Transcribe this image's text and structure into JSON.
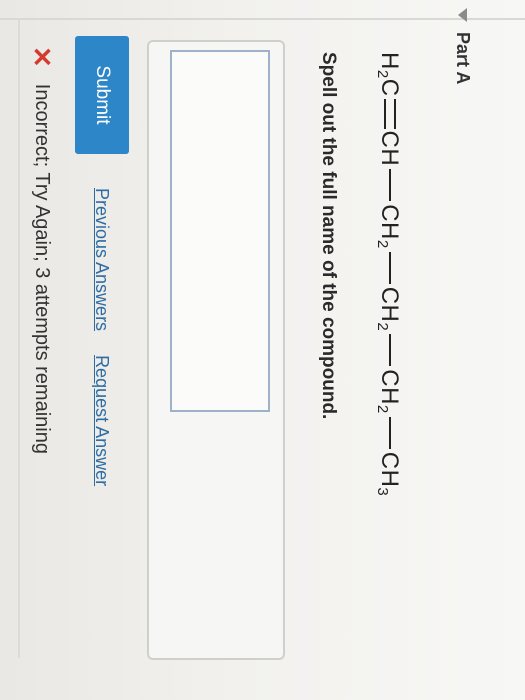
{
  "part": {
    "title": "Part A"
  },
  "question": {
    "formula": {
      "g1": "H",
      "g1_sub": "2",
      "g1_tail": "C",
      "g2": "CH",
      "g3": "CH",
      "g3_sub": "2",
      "g4": "CH",
      "g4_sub": "2",
      "g5": "CH",
      "g5_sub": "2",
      "g6": "CH",
      "g6_sub": "3"
    },
    "instruction": "Spell out the full name of the compound."
  },
  "answer": {
    "value": "",
    "placeholder": ""
  },
  "actions": {
    "submit_label": "Submit",
    "previous_answers_label": "Previous Answers",
    "request_answer_label": "Request Answer"
  },
  "feedback": {
    "icon": "x-mark",
    "text": "Incorrect; Try Again; 3 attempts remaining",
    "color": "#d43a2f"
  },
  "colors": {
    "submit": "#2d86c8",
    "link": "#2e6da4"
  }
}
